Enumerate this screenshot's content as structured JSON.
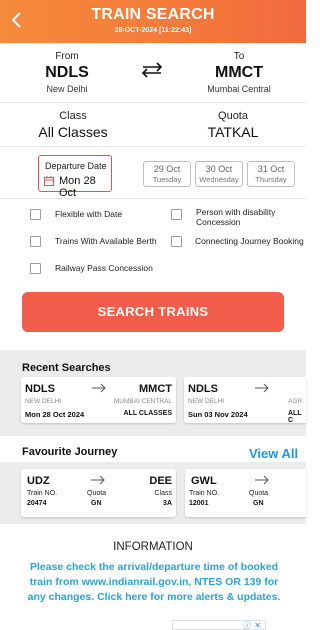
{
  "header": {
    "title": "TRAIN SEARCH",
    "subtitle": "28-OCT-2024 [11:22:43]",
    "back_icon": "chevron-left-icon",
    "gradient": [
      "#f58a3a",
      "#f06a3f"
    ]
  },
  "route": {
    "from": {
      "label": "From",
      "code": "NDLS",
      "name": "New Delhi"
    },
    "to": {
      "label": "To",
      "code": "MMCT",
      "name": "Mumbai Central"
    },
    "swap_icon": "swap-arrows-icon"
  },
  "class": {
    "label": "Class",
    "value": "All Classes"
  },
  "quota": {
    "label": "Quota",
    "value": "TATKAL"
  },
  "departure": {
    "label": "Departure Date",
    "value": "Mon 28 Oct",
    "icon": "calendar-icon"
  },
  "date_chips": [
    {
      "date": "29 Oct",
      "day": "Tuesday"
    },
    {
      "date": "30 Oct",
      "day": "Wednesday"
    },
    {
      "date": "31 Oct",
      "day": "Thursday"
    }
  ],
  "options": {
    "flexible": "Flexible with Date",
    "disability": "Person with disability Concession",
    "available_berth": "Trains With Available Berth",
    "connecting": "Connecting Journey Booking",
    "railway_pass": "Railway Pass Concession"
  },
  "search_button": "SEARCH TRAINS",
  "recent": {
    "title": "Recent Searches",
    "items": [
      {
        "from": "NDLS",
        "to": "MMCT",
        "from_name": "NEW DELHI",
        "to_name": "MUMBAI CENTRAL",
        "date": "Mon 28 Oct 2024",
        "class": "ALL CLASSES"
      },
      {
        "from": "NDLS",
        "to": "",
        "from_name": "NEW DELHI",
        "to_name": "AGR",
        "date": "Sun 03 Nov 2024",
        "class": "ALL C"
      }
    ]
  },
  "favourite": {
    "title": "Favourite Journey",
    "view_all": "View All",
    "items": [
      {
        "from": "UDZ",
        "to": "DEE",
        "train_label": "Train NO.",
        "train_no": "20474",
        "quota_label": "Quota",
        "quota": "GN",
        "class_label": "Class",
        "class": "3A"
      },
      {
        "from": "GWL",
        "to": "",
        "train_label": "Train NO.",
        "train_no": "12001",
        "quota_label": "Quota",
        "quota": "GN",
        "class_label": "",
        "class": ""
      }
    ]
  },
  "information": {
    "title": "INFORMATION",
    "text": "Please check the arrival/departure time of booked train from www.indianrail.gov.in, NTES OR 139 for any changes. Click here for more alerts & updates."
  },
  "colors": {
    "accent": "#f25c4a",
    "link": "#1b9bd6",
    "info_text": "#2aa3da",
    "selected_border": "#e05252"
  }
}
